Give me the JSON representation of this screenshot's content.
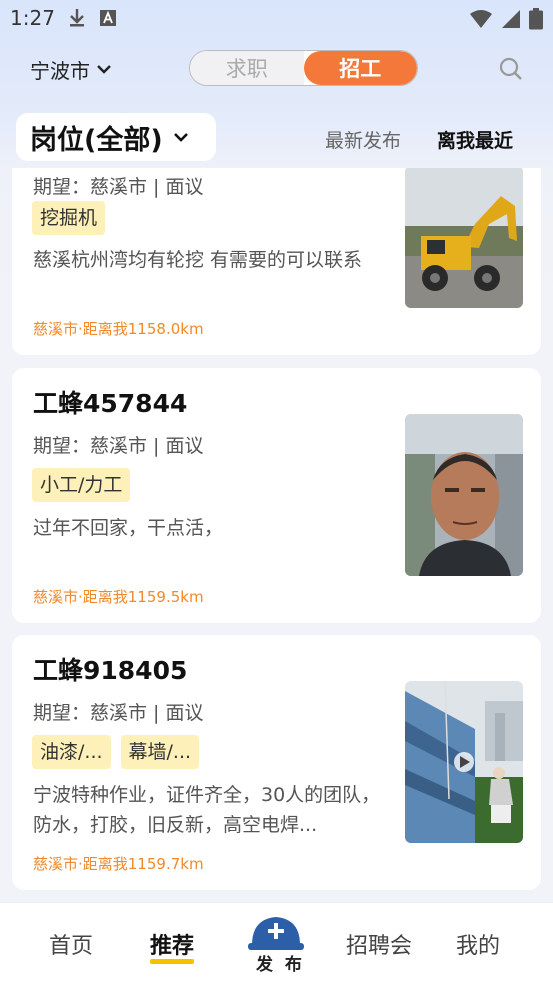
{
  "status_bar": {
    "time": "1:27",
    "icons": [
      "download-icon",
      "font-a-icon",
      "wifi-icon",
      "signal-icon",
      "battery-icon"
    ]
  },
  "header": {
    "city": "宁波市",
    "segments": [
      "求职",
      "招工"
    ],
    "active_segment": "招工",
    "search_icon": "search-icon"
  },
  "filter": {
    "position_label": "岗位(全部)",
    "sort_latest": "最新发布",
    "sort_nearest": "离我最近",
    "active_sort": "离我最近"
  },
  "cards": [
    {
      "title": "",
      "expect": "期望：慈溪市 | 面议",
      "tags": [
        "挖掘机"
      ],
      "desc": "慈溪杭州湾均有轮挖 有需要的可以联系",
      "distance": "慈溪市·距离我1158.0km",
      "photo": "excavator-photo"
    },
    {
      "title": "工蜂457844",
      "expect": "期望：慈溪市 | 面议",
      "tags": [
        "小工/力工"
      ],
      "desc": "过年不回家，干点活，",
      "distance": "慈溪市·距离我1159.5km",
      "photo": "portrait-photo"
    },
    {
      "title": "工蜂918405",
      "expect": "期望：慈溪市 | 面议",
      "tags": [
        "油漆/...",
        "幕墙/..."
      ],
      "desc": "宁波特种作业，证件齐全，30人的团队，防水，打胶，旧反新，高空电焊...",
      "distance": "慈溪市·距离我1159.7km",
      "photo": "facade-worker-video"
    }
  ],
  "bottom_nav": {
    "items": [
      "首页",
      "推荐",
      "发布",
      "招聘会",
      "我的"
    ],
    "active": "推荐",
    "publish_label": "发 布"
  },
  "colors": {
    "accent": "#f4783a",
    "tag_bg": "#fdf0b8",
    "distance": "#f08a2a",
    "nav_underline": "#f6c100",
    "publish_blue": "#2d5fa8"
  }
}
